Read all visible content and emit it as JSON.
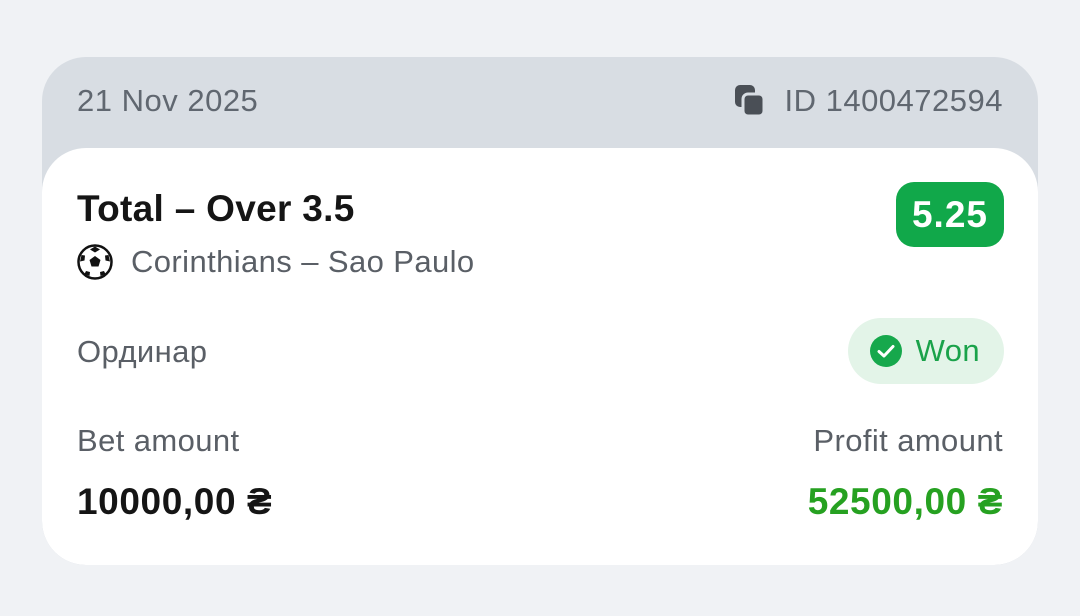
{
  "bet": {
    "date": "21 Nov 2025",
    "id_text": "ID 1400472594",
    "title": "Total – Over 3.5",
    "odds": "5.25",
    "match": "Corinthians – Sao Paulo",
    "sport_icon": "soccer-ball-icon",
    "bet_type": "Ординар",
    "status": "Won",
    "status_icon": "check-circle-icon",
    "bet_amount_label": "Bet amount",
    "bet_amount": "10000,00 ₴",
    "profit_amount_label": "Profit amount",
    "profit_amount": "52500,00 ₴"
  },
  "colors": {
    "odds_badge": "#11a84a",
    "status_text": "#1aa24a",
    "status_bg": "#e3f4e8",
    "profit_value": "#26a121",
    "header_bg": "#d8dde3",
    "page_bg": "#f0f2f5"
  }
}
